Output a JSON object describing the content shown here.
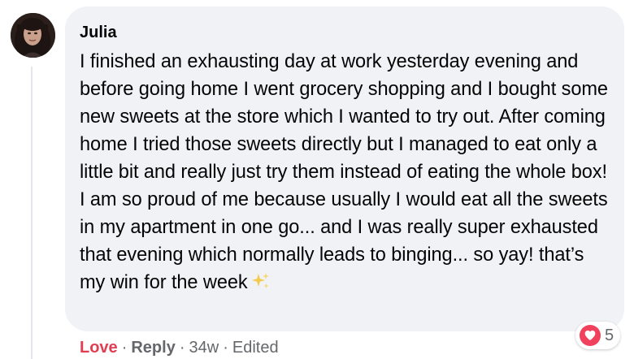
{
  "comment": {
    "author": "Julia",
    "text": "I finished an exhausting day at work yesterday evening and before going home I went grocery shopping and I bought some new sweets at the store which I wanted to try out. After coming home I tried those sweets directly but I managed to eat only a little bit and really just try them instead of eating the whole box! I am so proud of me because usually I would eat all the sweets in my apartment in one go... and I was really super exhausted that evening which normally leads to binging... so yay! that’s my win for the week",
    "emoji": "sparkles-icon"
  },
  "actions": {
    "love_label": "Love",
    "reply_label": "Reply",
    "time": "34w",
    "edited": "Edited",
    "separator": "·"
  },
  "reactions": {
    "icon": "heart-icon",
    "count": "5",
    "love_color": "#e03e52",
    "badge_color": "#f0425d"
  }
}
